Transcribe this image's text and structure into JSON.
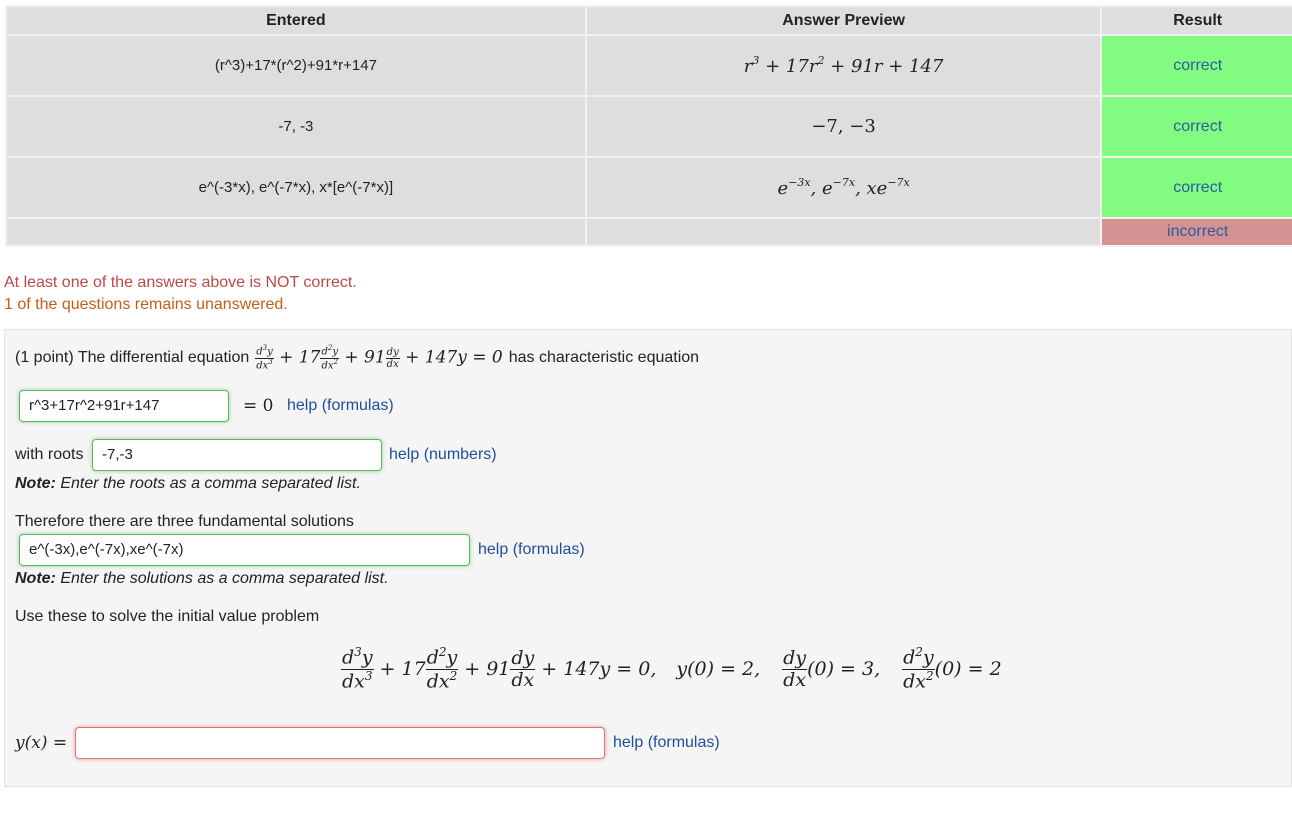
{
  "results": {
    "headers": [
      "Entered",
      "Answer Preview",
      "Result"
    ],
    "rows": [
      {
        "entered": "(r^3)+17*(r^2)+91*r+147",
        "result": "correct"
      },
      {
        "entered": "-7, -3",
        "preview": "−7, −3",
        "result": "correct"
      },
      {
        "entered": "e^(-3*x), e^(-7*x), x*[e^(-7*x)]",
        "result": "correct"
      },
      {
        "entered": "",
        "preview": "",
        "result": "incorrect"
      }
    ]
  },
  "messages": {
    "not_correct": "At least one of the answers above is NOT correct.",
    "unanswered": "1 of the questions remains unanswered."
  },
  "problem": {
    "intro": "(1 point) The differential equation",
    "has_char": "has characteristic equation",
    "equals_zero": "= 0",
    "answer1": "r^3+17r^2+91r+147",
    "help_formulas": "help (formulas)",
    "with_roots": "with roots",
    "answer2": "-7,-3",
    "help_numbers": "help (numbers)",
    "note_label": "Note:",
    "note_roots": "Enter the roots as a comma separated list.",
    "fundamental": "Therefore there are three fundamental solutions",
    "answer3": "e^(-3x),e^(-7x),xe^(-7x)",
    "note_solutions": "Enter the solutions as a comma separated list.",
    "use_these": "Use these to solve the initial value problem",
    "answer4": ""
  },
  "colors": {
    "correct": "#81fc81",
    "incorrect": "#d49393",
    "link": "#1f4e9a"
  }
}
